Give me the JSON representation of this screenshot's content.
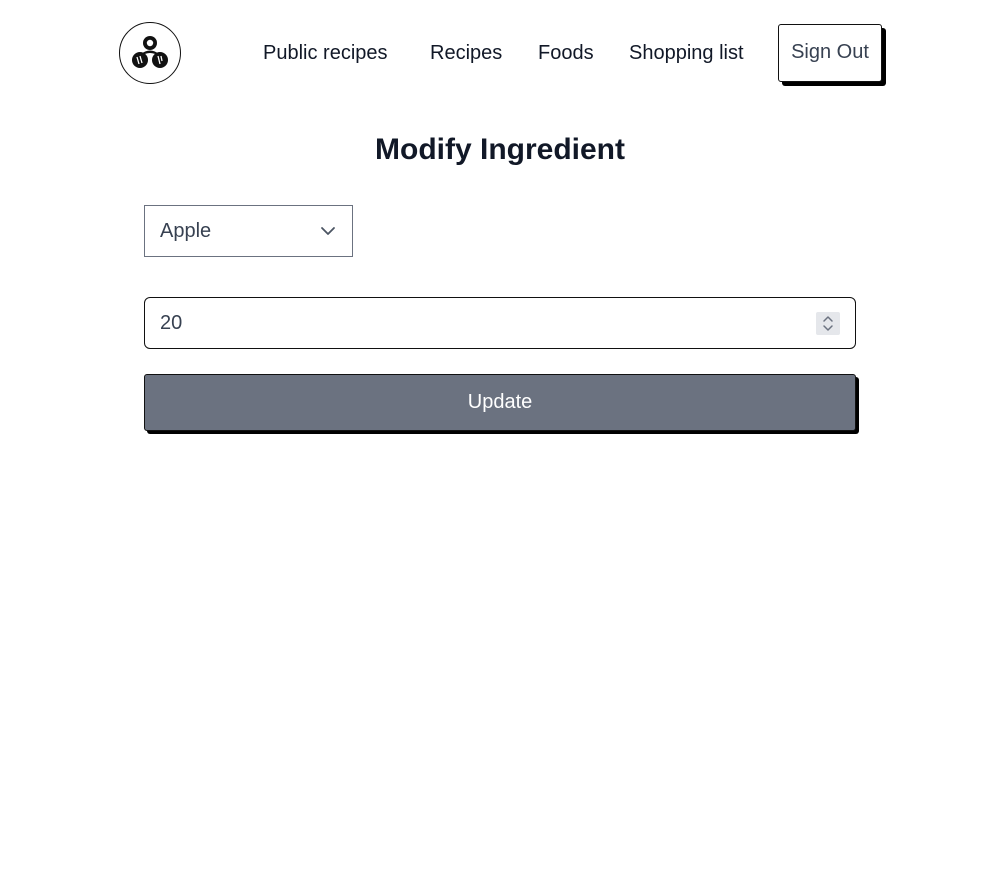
{
  "nav": {
    "logo_icon": "chef-food-logo-icon",
    "links": {
      "public_recipes": "Public recipes",
      "recipes": "Recipes",
      "foods": "Foods",
      "shopping_list": "Shopping list"
    },
    "sign_out": "Sign Out"
  },
  "main": {
    "title": "Modify Ingredient",
    "food_select": {
      "selected": "Apple",
      "icon": "chevron-down-icon"
    },
    "quantity": {
      "value": "20",
      "icon": "spinner-arrows-icon"
    },
    "submit_label": "Update"
  },
  "colors": {
    "button_bg": "#6b7280",
    "text": "#111827",
    "border": "#111111",
    "shadow": "#000000"
  }
}
